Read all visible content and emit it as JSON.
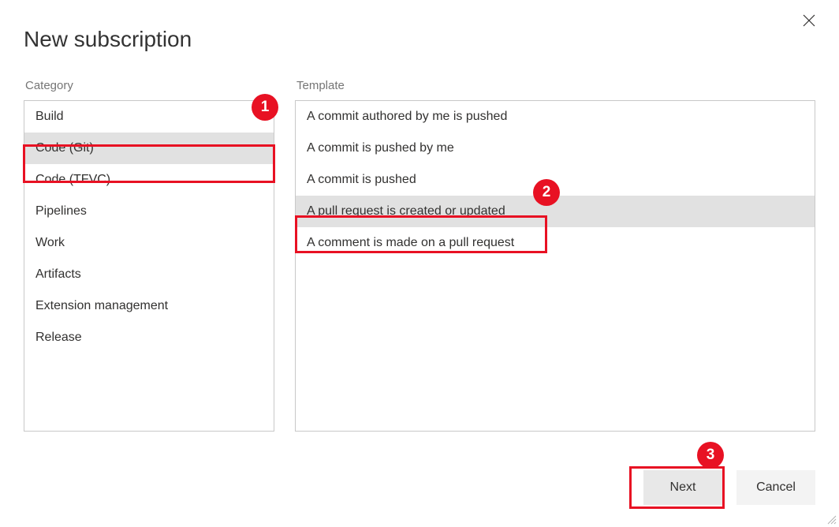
{
  "dialog": {
    "title": "New subscription",
    "closeLabel": "Close"
  },
  "labels": {
    "category": "Category",
    "template": "Template"
  },
  "categories": {
    "items": [
      {
        "label": "Build"
      },
      {
        "label": "Code (Git)"
      },
      {
        "label": "Code (TFVC)"
      },
      {
        "label": "Pipelines"
      },
      {
        "label": "Work"
      },
      {
        "label": "Artifacts"
      },
      {
        "label": "Extension management"
      },
      {
        "label": "Release"
      }
    ],
    "selectedIndex": 1
  },
  "templates": {
    "items": [
      {
        "label": "A commit authored by me is pushed"
      },
      {
        "label": "A commit is pushed by me"
      },
      {
        "label": "A commit is pushed"
      },
      {
        "label": "A pull request is created or updated"
      },
      {
        "label": "A comment is made on a pull request"
      }
    ],
    "selectedIndex": 3
  },
  "buttons": {
    "next": "Next",
    "cancel": "Cancel"
  },
  "annotations": {
    "badge1": "1",
    "badge2": "2",
    "badge3": "3",
    "highlightColor": "#e81123"
  }
}
